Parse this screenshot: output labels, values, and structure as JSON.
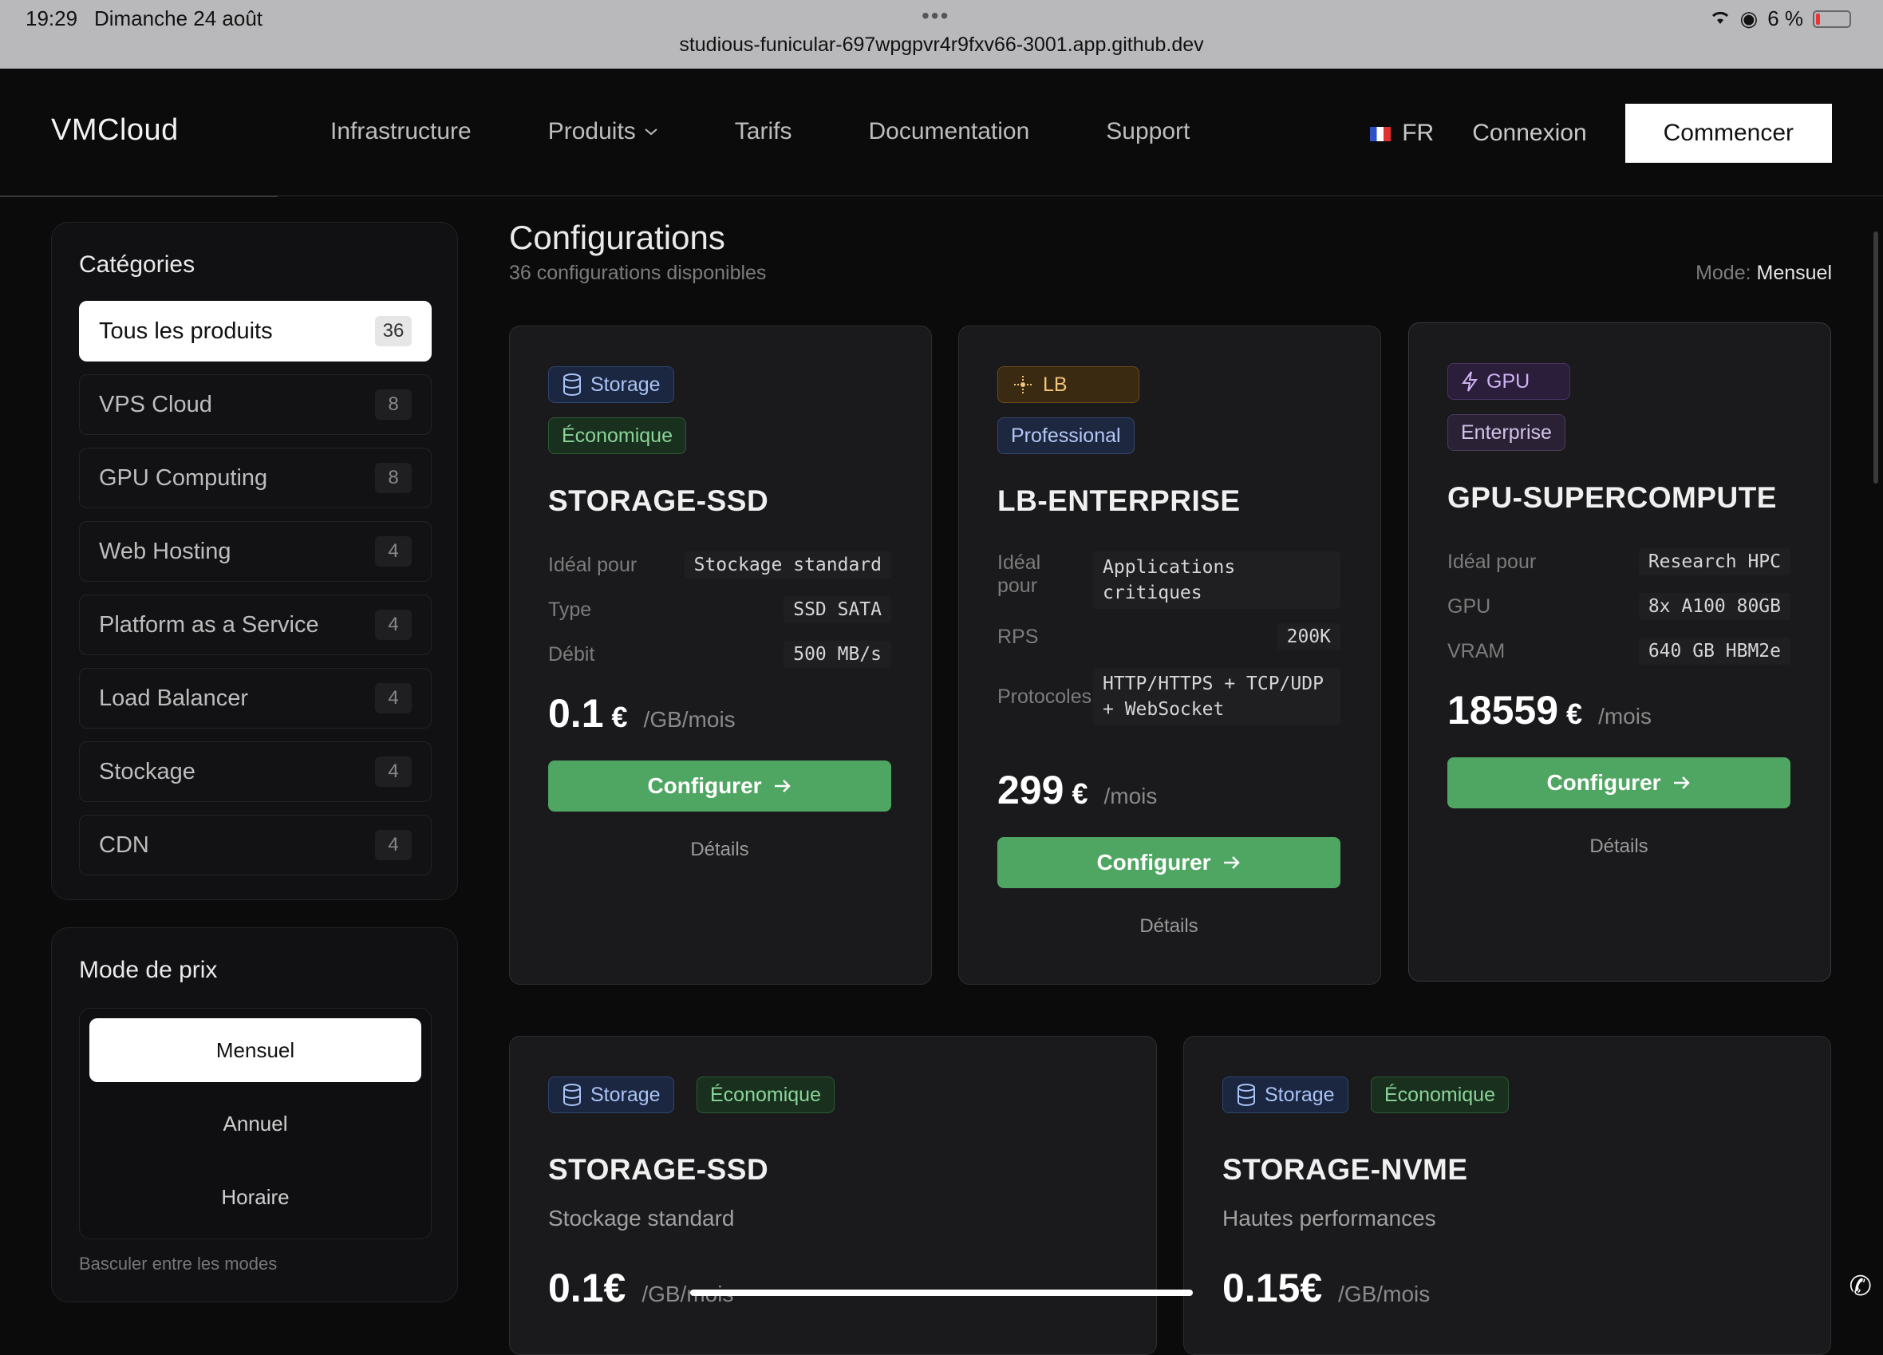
{
  "status": {
    "time": "19:29",
    "date": "Dimanche 24 août",
    "url": "studious-funicular-697wpgpvr4r9fxv66-3001.app.github.dev",
    "battery": "6 %",
    "battery_color": "#e33333"
  },
  "nav": {
    "logo": "VMCloud",
    "links": [
      "Infrastructure",
      "Produits",
      "Tarifs",
      "Documentation",
      "Support"
    ],
    "lang": "FR",
    "login": "Connexion",
    "cta": "Commencer"
  },
  "categories": {
    "title": "Catégories",
    "items": [
      {
        "label": "Tous les produits",
        "count": "36"
      },
      {
        "label": "VPS Cloud",
        "count": "8"
      },
      {
        "label": "GPU Computing",
        "count": "8"
      },
      {
        "label": "Web Hosting",
        "count": "4"
      },
      {
        "label": "Platform as a Service",
        "count": "4"
      },
      {
        "label": "Load Balancer",
        "count": "4"
      },
      {
        "label": "Stockage",
        "count": "4"
      },
      {
        "label": "CDN",
        "count": "4"
      }
    ]
  },
  "pricing_mode": {
    "title": "Mode de prix",
    "options": [
      "Mensuel",
      "Annuel",
      "Horaire"
    ],
    "hint": "Basculer entre les modes"
  },
  "main": {
    "title": "Configurations",
    "subtitle": "36 configurations disponibles",
    "mode_label": "Mode:",
    "mode_value": "Mensuel"
  },
  "cards": [
    {
      "category": "Storage",
      "tier": "Économique",
      "name": "STORAGE-SSD",
      "specs": [
        {
          "k": "Idéal pour",
          "v": "Stockage standard"
        },
        {
          "k": "Type",
          "v": "SSD SATA"
        },
        {
          "k": "Débit",
          "v": "500 MB/s"
        }
      ],
      "price": "0.1",
      "currency": "€",
      "period": "/GB/mois",
      "cta": "Configurer",
      "details": "Détails"
    },
    {
      "category": "LB",
      "tier": "Professional",
      "name": "LB-ENTERPRISE",
      "specs": [
        {
          "k": "Idéal pour",
          "v": "Applications critiques"
        },
        {
          "k": "RPS",
          "v": "200K"
        },
        {
          "k": "Protocoles",
          "v": "HTTP/HTTPS + TCP/UDP + WebSocket"
        }
      ],
      "price": "299",
      "currency": "€",
      "period": "/mois",
      "cta": "Configurer",
      "details": "Détails"
    },
    {
      "category": "GPU",
      "tier": "Enterprise",
      "name": "GPU-SUPERCOMPUTE",
      "specs": [
        {
          "k": "Idéal pour",
          "v": "Research HPC"
        },
        {
          "k": "GPU",
          "v": "8x A100 80GB"
        },
        {
          "k": "VRAM",
          "v": "640 GB HBM2e"
        }
      ],
      "price": "18559",
      "currency": "€",
      "period": "/mois",
      "cta": "Configurer",
      "details": "Détails"
    },
    {
      "category": "Storage",
      "tier": "Économique",
      "name": "STORAGE-SSD",
      "description": "Stockage standard",
      "price": "0.1€",
      "period": "/GB/mois"
    },
    {
      "category": "Storage",
      "tier": "Économique",
      "name": "STORAGE-NVME",
      "description": "Hautes performances",
      "price": "0.15€",
      "period": "/GB/mois"
    }
  ]
}
